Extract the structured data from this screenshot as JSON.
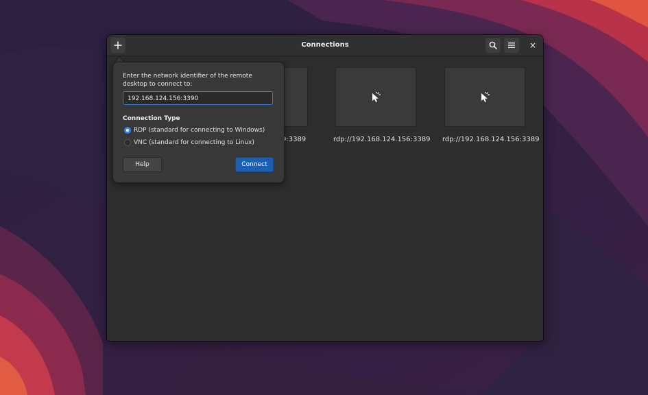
{
  "window": {
    "title": "Connections",
    "add_icon": "plus-icon",
    "search_icon": "search-icon",
    "menu_icon": "hamburger-menu-icon",
    "close_icon": "close-icon",
    "close_glyph": "×"
  },
  "connections": [
    {
      "label": "rdp://192.168.124.156:3389",
      "visible_label": "9:3389",
      "icon": "remote-pointer-icon"
    },
    {
      "label": "rdp://192.168.124.156:3389",
      "visible_label": "rdp://192.168.124.156:3389",
      "icon": "remote-pointer-icon"
    },
    {
      "label": "rdp://192.168.124.156:3389",
      "visible_label": "rdp://192.168.124.156:3389",
      "icon": "remote-pointer-icon"
    }
  ],
  "popover": {
    "prompt": "Enter the network identifier of the remote desktop to connect to:",
    "address_value": "192.168.124.156:3390",
    "connection_type_heading": "Connection Type",
    "options": [
      {
        "label": "RDP (standard for connecting to Windows)",
        "selected": true
      },
      {
        "label": "VNC (standard for connecting to Linux)",
        "selected": false
      }
    ],
    "help_label": "Help",
    "connect_label": "Connect"
  },
  "colors": {
    "accent": "#3584e4",
    "connect_button": "#1c5fb0",
    "window_bg": "#2d2d2d",
    "headerbar_bg": "#303030"
  }
}
